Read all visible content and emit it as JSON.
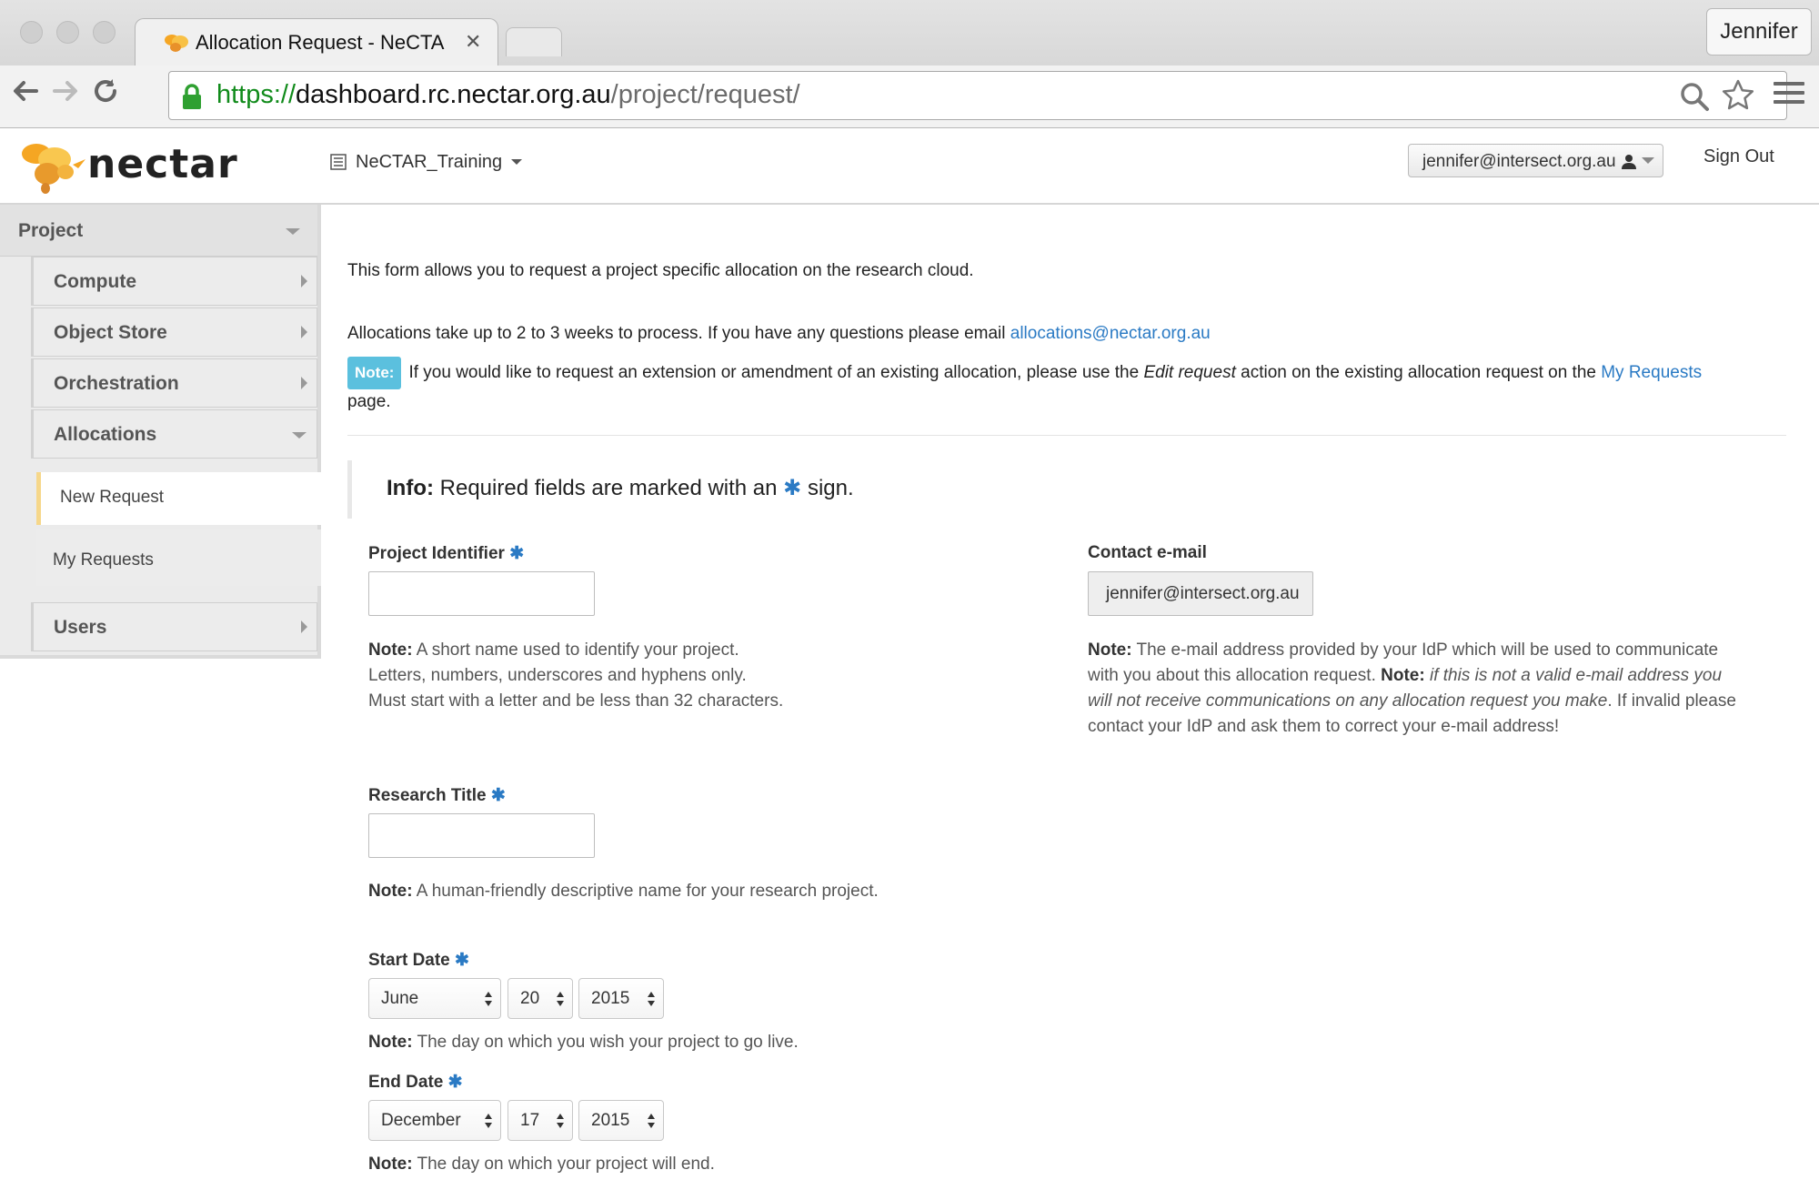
{
  "browser": {
    "tab_title": "Allocation Request - NeCTA",
    "profile_name": "Jennifer",
    "url_scheme": "https://",
    "url_host": "dashboard.rc.nectar.org.au",
    "url_path": "/project/request/"
  },
  "header": {
    "logo_text": "nectar",
    "project_name": "NeCTAR_Training",
    "user_email": "jennifer@intersect.org.au",
    "sign_out": "Sign Out"
  },
  "sidebar": {
    "section": "Project",
    "items": [
      {
        "label": "Compute"
      },
      {
        "label": "Object Store"
      },
      {
        "label": "Orchestration"
      },
      {
        "label": "Allocations"
      },
      {
        "label": "Users"
      }
    ],
    "subitems": [
      {
        "label": "New Request"
      },
      {
        "label": "My Requests"
      }
    ]
  },
  "main": {
    "intro": "This form allows you to request a project specific allocation on the research cloud.",
    "process_text": "Allocations take up to 2 to 3 weeks to process. If you have any questions please email ",
    "process_email": "allocations@nectar.org.au",
    "note_badge": "Note:",
    "note_text_1": "If you would like to request an extension or amendment of an existing allocation, please use the ",
    "note_italic": "Edit request",
    "note_text_2": " action on the existing allocation request on the ",
    "note_link": "My Requests",
    "note_text_3": "page.",
    "info_bold": "Info:",
    "info_text_1": " Required fields are marked with an ",
    "info_text_2": " sign."
  },
  "form": {
    "note_label": "Note:",
    "project_identifier": {
      "label": "Project Identifier",
      "value": "",
      "note_1": " A short name used to identify your project.",
      "note_2": "Letters, numbers, underscores and hyphens only.",
      "note_3": "Must start with a letter and be less than 32 characters."
    },
    "contact_email": {
      "label": "Contact e-mail",
      "value": "jennifer@intersect.org.au",
      "note_1": " The e-mail address provided by your IdP which will be used to communicate",
      "note_2": "with you about this allocation request. ",
      "note_2_bold": "Note:",
      "note_2_italic": " if this is not a valid e-mail address you",
      "note_3_italic": "will not receive communications on any allocation request you make",
      "note_3": ". If invalid please",
      "note_4": "contact your IdP and ask them to correct your e-mail address!"
    },
    "research_title": {
      "label": "Research Title",
      "value": "",
      "note": " A human-friendly descriptive name for your research project."
    },
    "start_date": {
      "label": "Start Date",
      "month": "June",
      "day": "20",
      "year": "2015",
      "note": " The day on which you wish your project to go live."
    },
    "end_date": {
      "label": "End Date",
      "month": "December",
      "day": "17",
      "year": "2015",
      "note": " The day on which your project will end."
    }
  },
  "colors": {
    "link": "#2a7ac4",
    "note_badge": "#5bc0de",
    "active_accent": "#f6d78a",
    "url_scheme": "#118b1b"
  }
}
